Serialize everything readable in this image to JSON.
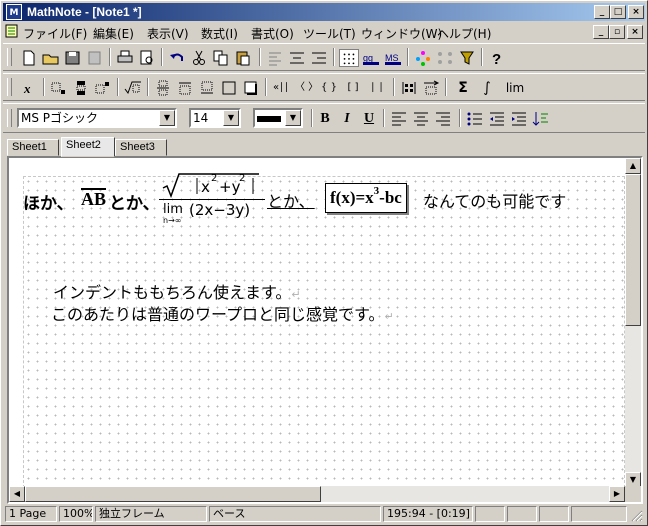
{
  "window": {
    "app_icon_text": "M",
    "title": "MathNote - [Note1 *]",
    "caption_minimize": "_",
    "caption_maximize": "□",
    "caption_close": "×"
  },
  "menu": {
    "items": [
      "ファイル(F)",
      "編集(E)",
      "表示(V)",
      "数式(I)",
      "書式(O)",
      "ツール(T)",
      "ウィンドウ(W)",
      "ヘルプ(H)"
    ],
    "mdi_minimize": "_",
    "mdi_restore": "▫",
    "mdi_close": "×"
  },
  "toolbar2": {
    "text_icons": [
      "«∣∣",
      "〈 〉",
      "{ }",
      "[ ]",
      "∣ ∣"
    ],
    "sigma": "Σ",
    "integral": "∫",
    "lim": "lim"
  },
  "format_bar": {
    "font_name": "MS Pゴシック",
    "font_size": "14",
    "bold": "B",
    "italic": "I",
    "underline": "U"
  },
  "tabs": [
    "Sheet1",
    "Sheet2",
    "Sheet3"
  ],
  "active_tab": "Sheet2",
  "document": {
    "line1": {
      "text_a": "ほか、",
      "overline_expr": "AB",
      "text_b": "とか、",
      "frac_num_inner": "x",
      "frac_num_sup1": "2",
      "frac_num_plus": "+y",
      "frac_num_sup2": "2",
      "frac_den_lim": "lim",
      "frac_den_sub": "n→∞",
      "frac_den_expr": "(2x−3y)",
      "text_c": "とか、",
      "boxed_expr_a": "f(x)=x",
      "boxed_expr_sup": "3",
      "boxed_expr_b": "-bc",
      "text_d": "なんてのも可能です"
    },
    "line2": "インデントももちろん使えます。",
    "line3": "このあたりは普通のワープロと同じ感覚です。",
    "para_mark": "↵"
  },
  "scrollbar": {
    "up": "▲",
    "down": "▼",
    "left": "◀",
    "right": "▶"
  },
  "status": {
    "page": "1 Page",
    "zoom": "100%",
    "frame": "独立フレーム",
    "style": "ベース",
    "position": "195:94 - [0:19]"
  }
}
